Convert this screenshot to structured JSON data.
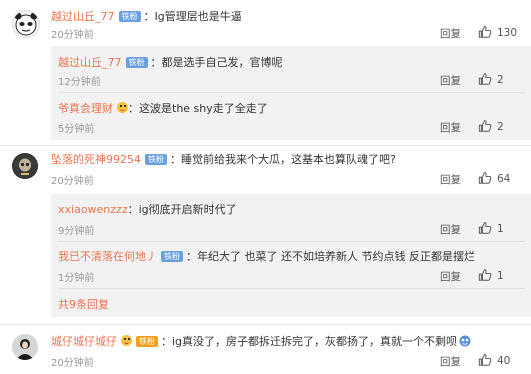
{
  "reply_label": "回复",
  "comments": [
    {
      "user": "越过山丘_77",
      "badge": "铁粉",
      "text": "：Ig管理层也是牛逼",
      "time": "20分钟前",
      "likes": "130",
      "replies": [
        {
          "user": "越过山丘_77",
          "badge": "铁粉",
          "text": "：都是选手自己发，官博呢",
          "time": "12分钟前",
          "likes": "2"
        },
        {
          "user": "爷真会理财",
          "text": "：这波是the shy走了全走了",
          "time": "5分钟前",
          "likes": "2"
        }
      ]
    },
    {
      "user": "坠落的死神99254",
      "badge": "铁粉",
      "text": "：睡觉前给我来个大瓜，这基本也算队魂了吧?",
      "time": "20分钟前",
      "likes": "64",
      "replies": [
        {
          "user": "xxiaowenzzz",
          "text": "：ig彻底开启新时代了",
          "time": "9分钟前",
          "likes": "1"
        },
        {
          "user": "我已不清落在何地丿",
          "badge": "铁粉",
          "text": "：年纪大了 也菜了 还不如培养新人 节约点钱 反正都是摆烂",
          "time": "1分钟前",
          "likes": "1"
        }
      ],
      "more": "共9条回复"
    },
    {
      "user": "城仔城仔城仔",
      "badge": "铁粉",
      "text": "：ig真没了，房子都拆迁拆完了，灰都扬了，真就一个不剩呗",
      "time": "20分钟前",
      "likes": "40"
    }
  ],
  "colors": {
    "username": "#eb7350",
    "badge": "#6aa0e0",
    "badge_gold": "#f0a020",
    "time": "#999999"
  }
}
